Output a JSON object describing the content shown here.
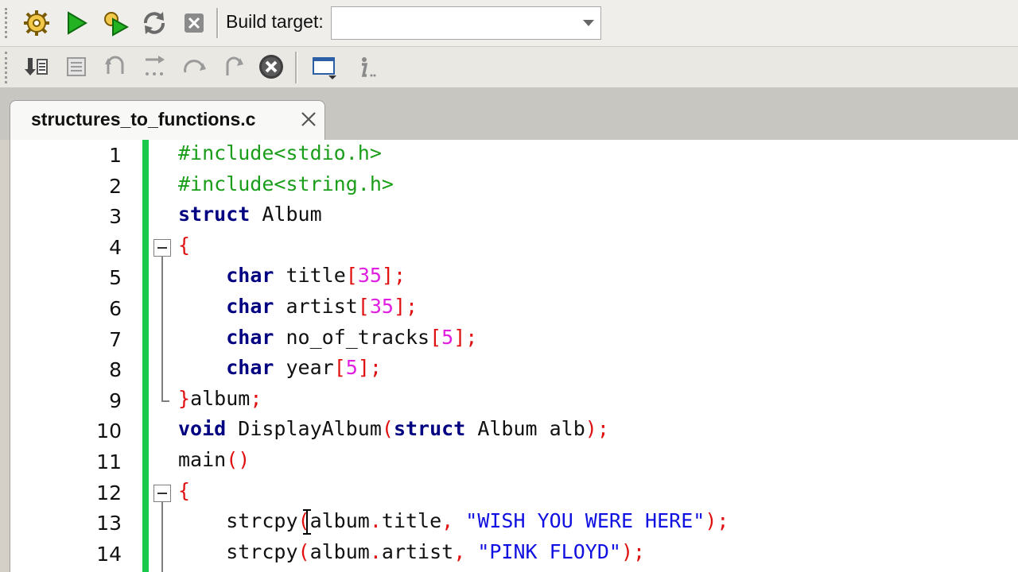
{
  "toolbar": {
    "build_target_label": "Build target:",
    "build_target_value": "",
    "icons": [
      "gear-icon",
      "run-icon",
      "build-run-icon",
      "rebuild-icon",
      "abort-icon",
      "debug-step-into-icon",
      "debug-window-icon",
      "step-out-icon",
      "next-line-icon",
      "step-over-icon",
      "next-instruction-icon",
      "stop-debugger-icon",
      "debug-windows-icon",
      "info-icon"
    ]
  },
  "tab": {
    "label": "structures_to_functions.c"
  },
  "editor": {
    "lines": [
      [
        {
          "t": "#include<stdio.h>",
          "c": "pp"
        }
      ],
      [
        {
          "t": "#include<string.h>",
          "c": "pp"
        }
      ],
      [
        {
          "t": "struct",
          "c": "kw"
        },
        {
          "t": " Album",
          "c": ""
        }
      ],
      [
        {
          "t": "{",
          "c": "br"
        }
      ],
      [
        {
          "t": "    ",
          "c": ""
        },
        {
          "t": "char",
          "c": "kw"
        },
        {
          "t": " title",
          "c": ""
        },
        {
          "t": "[",
          "c": "br"
        },
        {
          "t": "35",
          "c": "num"
        },
        {
          "t": "];",
          "c": "br"
        }
      ],
      [
        {
          "t": "    ",
          "c": ""
        },
        {
          "t": "char",
          "c": "kw"
        },
        {
          "t": " artist",
          "c": ""
        },
        {
          "t": "[",
          "c": "br"
        },
        {
          "t": "35",
          "c": "num"
        },
        {
          "t": "];",
          "c": "br"
        }
      ],
      [
        {
          "t": "    ",
          "c": ""
        },
        {
          "t": "char",
          "c": "kw"
        },
        {
          "t": " no_of_tracks",
          "c": ""
        },
        {
          "t": "[",
          "c": "br"
        },
        {
          "t": "5",
          "c": "num"
        },
        {
          "t": "];",
          "c": "br"
        }
      ],
      [
        {
          "t": "    ",
          "c": ""
        },
        {
          "t": "char",
          "c": "kw"
        },
        {
          "t": " year",
          "c": ""
        },
        {
          "t": "[",
          "c": "br"
        },
        {
          "t": "5",
          "c": "num"
        },
        {
          "t": "];",
          "c": "br"
        }
      ],
      [
        {
          "t": "}",
          "c": "br"
        },
        {
          "t": "album",
          "c": ""
        },
        {
          "t": ";",
          "c": "br"
        }
      ],
      [
        {
          "t": "void",
          "c": "kw"
        },
        {
          "t": " DisplayAlbum",
          "c": ""
        },
        {
          "t": "(",
          "c": "br"
        },
        {
          "t": "struct",
          "c": "kw"
        },
        {
          "t": " Album alb",
          "c": ""
        },
        {
          "t": ");",
          "c": "br"
        }
      ],
      [
        {
          "t": "main",
          "c": ""
        },
        {
          "t": "()",
          "c": "br"
        }
      ],
      [
        {
          "t": "{",
          "c": "br"
        }
      ],
      [
        {
          "t": "    strcpy",
          "c": ""
        },
        {
          "t": "(",
          "c": "br"
        },
        {
          "t": "album",
          "c": ""
        },
        {
          "t": ".",
          "c": "br"
        },
        {
          "t": "title",
          "c": ""
        },
        {
          "t": ", ",
          "c": "br"
        },
        {
          "t": "\"WISH YOU WERE HERE\"",
          "c": "str"
        },
        {
          "t": ");",
          "c": "br"
        }
      ],
      [
        {
          "t": "    strcpy",
          "c": ""
        },
        {
          "t": "(",
          "c": "br"
        },
        {
          "t": "album",
          "c": ""
        },
        {
          "t": ".",
          "c": "br"
        },
        {
          "t": "artist",
          "c": ""
        },
        {
          "t": ", ",
          "c": "br"
        },
        {
          "t": "\"PINK FLOYD\"",
          "c": "str"
        },
        {
          "t": ");",
          "c": "br"
        }
      ]
    ],
    "line_numbers": [
      "1",
      "2",
      "3",
      "4",
      "5",
      "6",
      "7",
      "8",
      "9",
      "10",
      "11",
      "12",
      "13",
      "14"
    ]
  },
  "colors": {
    "change_bar": "#1ac94b",
    "preprocessor": "#1a9e1a",
    "keyword": "#000080",
    "operator": "#e01010",
    "number": "#e020e0",
    "string": "#1010e0"
  }
}
